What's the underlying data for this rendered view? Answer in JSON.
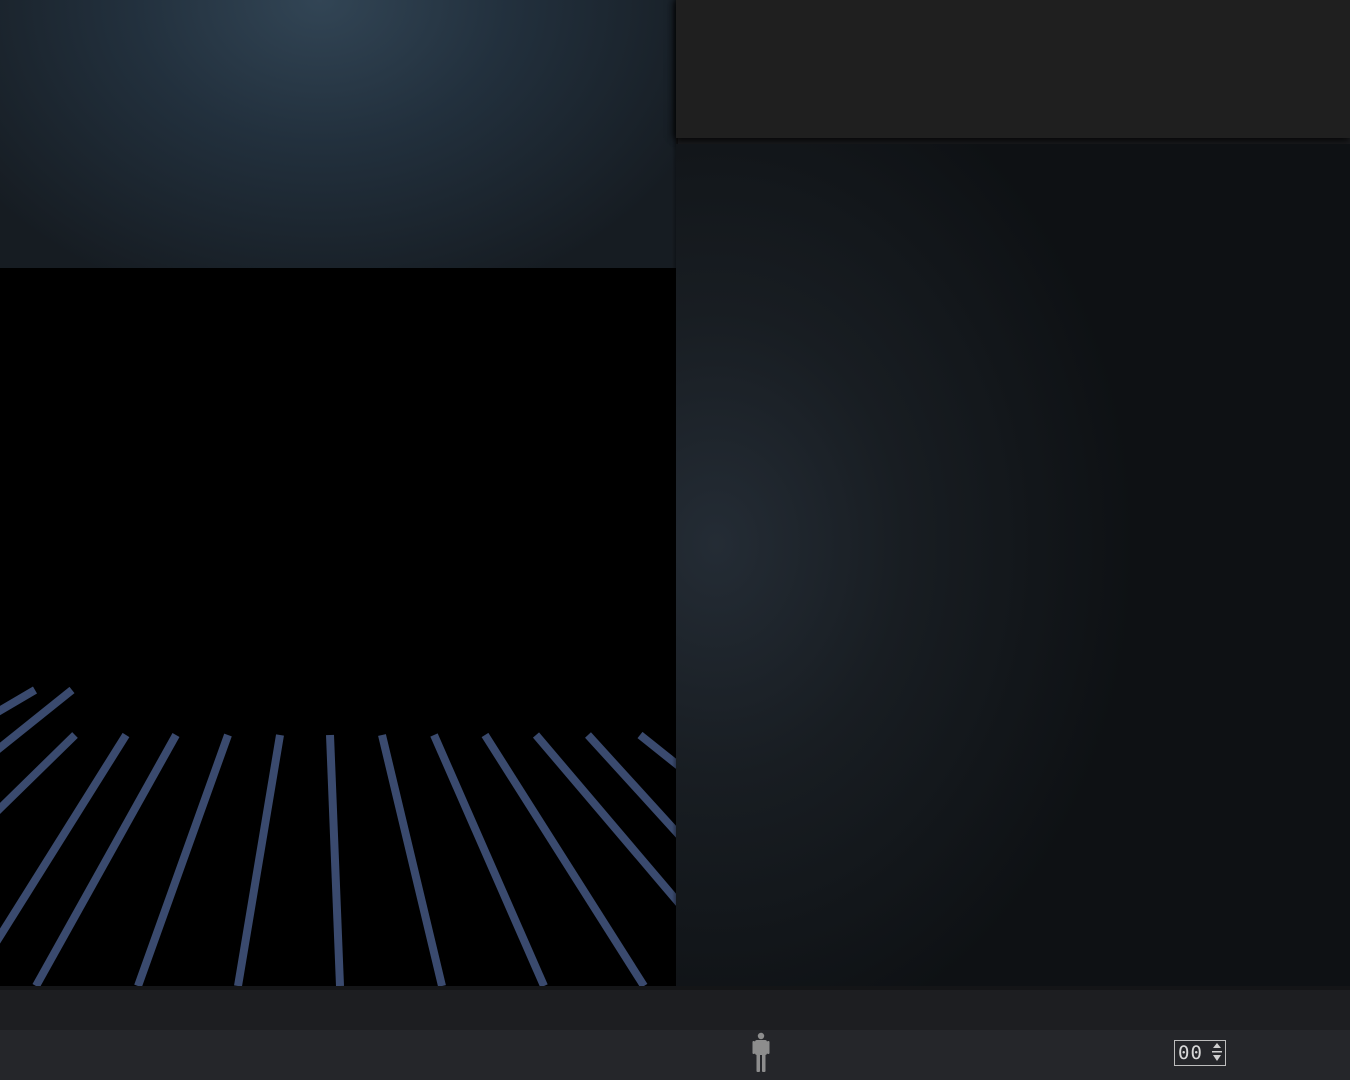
{
  "scene": {
    "floor_line_color": "#3a4a6e",
    "background_color": "#000000"
  },
  "status_bar": {
    "player_icon": "person-icon",
    "counter_value": "00",
    "counter_icon": "stepper-arrows-icon"
  }
}
